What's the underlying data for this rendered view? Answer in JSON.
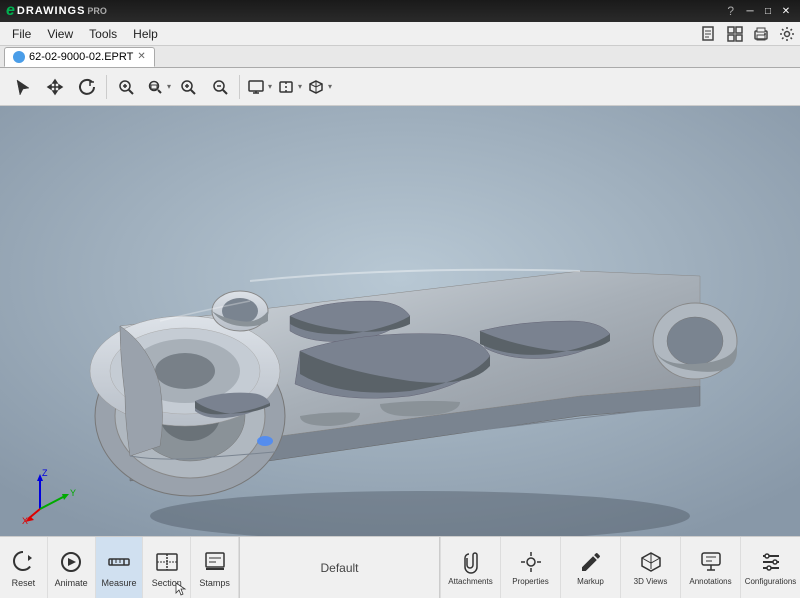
{
  "titlebar": {
    "logo_e": "e",
    "logo_text": "DRAWINGS",
    "logo_pro": "PRO",
    "question_mark": "?",
    "minimize": "─",
    "maximize": "□",
    "close": "✕"
  },
  "menubar": {
    "items": [
      "File",
      "View",
      "Tools",
      "Help"
    ],
    "icons": [
      "page",
      "grid",
      "print",
      "gear"
    ]
  },
  "tabbar": {
    "tabs": [
      {
        "label": "62-02-9000-02.EPRT",
        "active": true
      }
    ]
  },
  "toolbar": {
    "buttons": [
      {
        "name": "select",
        "icon": "↖",
        "tooltip": "Select"
      },
      {
        "name": "move",
        "icon": "✛",
        "tooltip": "Move"
      },
      {
        "name": "rotate",
        "icon": "↻",
        "tooltip": "Rotate"
      },
      {
        "name": "zoom-to-fit",
        "icon": "⊕",
        "tooltip": "Zoom to Fit"
      },
      {
        "name": "zoom-in",
        "icon": "🔍",
        "tooltip": "Zoom In"
      },
      {
        "name": "zoom-out",
        "icon": "🔍",
        "tooltip": "Zoom Out"
      },
      {
        "name": "display-mode",
        "icon": "🖥",
        "tooltip": "Display Mode"
      },
      {
        "name": "explode",
        "icon": "◈",
        "tooltip": "Explode"
      },
      {
        "name": "view-cube",
        "icon": "⬡",
        "tooltip": "View Cube"
      }
    ]
  },
  "viewport": {
    "background_color_top": "#8a9ab0",
    "background_color_bottom": "#c8d4dc"
  },
  "bottom_toolbar": {
    "left_buttons": [
      {
        "name": "reset",
        "label": "Reset",
        "icon": "⌂"
      },
      {
        "name": "animate",
        "label": "Animate",
        "icon": "↻"
      },
      {
        "name": "measure",
        "label": "Measure",
        "icon": "📐"
      },
      {
        "name": "section",
        "label": "Section",
        "icon": "▤"
      },
      {
        "name": "stamps",
        "label": "Stamps",
        "icon": "🗒"
      }
    ],
    "center_label": "Default",
    "right_buttons": [
      {
        "name": "attachments",
        "label": "Attachments",
        "icon": "📎"
      },
      {
        "name": "properties",
        "label": "Properties",
        "icon": "⚖"
      },
      {
        "name": "markup",
        "label": "Markup",
        "icon": "✎"
      },
      {
        "name": "3d-views",
        "label": "3D Views",
        "icon": "👁"
      },
      {
        "name": "annotations",
        "label": "Annotations",
        "icon": "🔖"
      },
      {
        "name": "configurations",
        "label": "Configurations",
        "icon": "≡"
      }
    ]
  }
}
